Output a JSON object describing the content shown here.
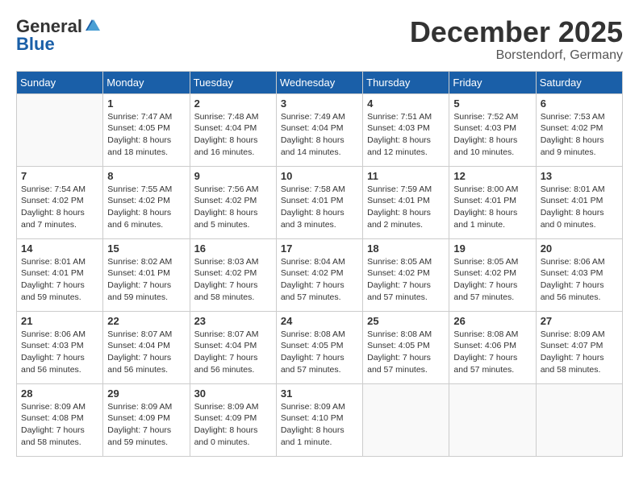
{
  "header": {
    "logo_line1": "General",
    "logo_line2": "Blue",
    "month": "December 2025",
    "location": "Borstendorf, Germany"
  },
  "weekdays": [
    "Sunday",
    "Monday",
    "Tuesday",
    "Wednesday",
    "Thursday",
    "Friday",
    "Saturday"
  ],
  "weeks": [
    [
      {
        "day": "",
        "info": ""
      },
      {
        "day": "1",
        "info": "Sunrise: 7:47 AM\nSunset: 4:05 PM\nDaylight: 8 hours\nand 18 minutes."
      },
      {
        "day": "2",
        "info": "Sunrise: 7:48 AM\nSunset: 4:04 PM\nDaylight: 8 hours\nand 16 minutes."
      },
      {
        "day": "3",
        "info": "Sunrise: 7:49 AM\nSunset: 4:04 PM\nDaylight: 8 hours\nand 14 minutes."
      },
      {
        "day": "4",
        "info": "Sunrise: 7:51 AM\nSunset: 4:03 PM\nDaylight: 8 hours\nand 12 minutes."
      },
      {
        "day": "5",
        "info": "Sunrise: 7:52 AM\nSunset: 4:03 PM\nDaylight: 8 hours\nand 10 minutes."
      },
      {
        "day": "6",
        "info": "Sunrise: 7:53 AM\nSunset: 4:02 PM\nDaylight: 8 hours\nand 9 minutes."
      }
    ],
    [
      {
        "day": "7",
        "info": "Sunrise: 7:54 AM\nSunset: 4:02 PM\nDaylight: 8 hours\nand 7 minutes."
      },
      {
        "day": "8",
        "info": "Sunrise: 7:55 AM\nSunset: 4:02 PM\nDaylight: 8 hours\nand 6 minutes."
      },
      {
        "day": "9",
        "info": "Sunrise: 7:56 AM\nSunset: 4:02 PM\nDaylight: 8 hours\nand 5 minutes."
      },
      {
        "day": "10",
        "info": "Sunrise: 7:58 AM\nSunset: 4:01 PM\nDaylight: 8 hours\nand 3 minutes."
      },
      {
        "day": "11",
        "info": "Sunrise: 7:59 AM\nSunset: 4:01 PM\nDaylight: 8 hours\nand 2 minutes."
      },
      {
        "day": "12",
        "info": "Sunrise: 8:00 AM\nSunset: 4:01 PM\nDaylight: 8 hours\nand 1 minute."
      },
      {
        "day": "13",
        "info": "Sunrise: 8:01 AM\nSunset: 4:01 PM\nDaylight: 8 hours\nand 0 minutes."
      }
    ],
    [
      {
        "day": "14",
        "info": "Sunrise: 8:01 AM\nSunset: 4:01 PM\nDaylight: 7 hours\nand 59 minutes."
      },
      {
        "day": "15",
        "info": "Sunrise: 8:02 AM\nSunset: 4:01 PM\nDaylight: 7 hours\nand 59 minutes."
      },
      {
        "day": "16",
        "info": "Sunrise: 8:03 AM\nSunset: 4:02 PM\nDaylight: 7 hours\nand 58 minutes."
      },
      {
        "day": "17",
        "info": "Sunrise: 8:04 AM\nSunset: 4:02 PM\nDaylight: 7 hours\nand 57 minutes."
      },
      {
        "day": "18",
        "info": "Sunrise: 8:05 AM\nSunset: 4:02 PM\nDaylight: 7 hours\nand 57 minutes."
      },
      {
        "day": "19",
        "info": "Sunrise: 8:05 AM\nSunset: 4:02 PM\nDaylight: 7 hours\nand 57 minutes."
      },
      {
        "day": "20",
        "info": "Sunrise: 8:06 AM\nSunset: 4:03 PM\nDaylight: 7 hours\nand 56 minutes."
      }
    ],
    [
      {
        "day": "21",
        "info": "Sunrise: 8:06 AM\nSunset: 4:03 PM\nDaylight: 7 hours\nand 56 minutes."
      },
      {
        "day": "22",
        "info": "Sunrise: 8:07 AM\nSunset: 4:04 PM\nDaylight: 7 hours\nand 56 minutes."
      },
      {
        "day": "23",
        "info": "Sunrise: 8:07 AM\nSunset: 4:04 PM\nDaylight: 7 hours\nand 56 minutes."
      },
      {
        "day": "24",
        "info": "Sunrise: 8:08 AM\nSunset: 4:05 PM\nDaylight: 7 hours\nand 57 minutes."
      },
      {
        "day": "25",
        "info": "Sunrise: 8:08 AM\nSunset: 4:05 PM\nDaylight: 7 hours\nand 57 minutes."
      },
      {
        "day": "26",
        "info": "Sunrise: 8:08 AM\nSunset: 4:06 PM\nDaylight: 7 hours\nand 57 minutes."
      },
      {
        "day": "27",
        "info": "Sunrise: 8:09 AM\nSunset: 4:07 PM\nDaylight: 7 hours\nand 58 minutes."
      }
    ],
    [
      {
        "day": "28",
        "info": "Sunrise: 8:09 AM\nSunset: 4:08 PM\nDaylight: 7 hours\nand 58 minutes."
      },
      {
        "day": "29",
        "info": "Sunrise: 8:09 AM\nSunset: 4:09 PM\nDaylight: 7 hours\nand 59 minutes."
      },
      {
        "day": "30",
        "info": "Sunrise: 8:09 AM\nSunset: 4:09 PM\nDaylight: 8 hours\nand 0 minutes."
      },
      {
        "day": "31",
        "info": "Sunrise: 8:09 AM\nSunset: 4:10 PM\nDaylight: 8 hours\nand 1 minute."
      },
      {
        "day": "",
        "info": ""
      },
      {
        "day": "",
        "info": ""
      },
      {
        "day": "",
        "info": ""
      }
    ]
  ]
}
